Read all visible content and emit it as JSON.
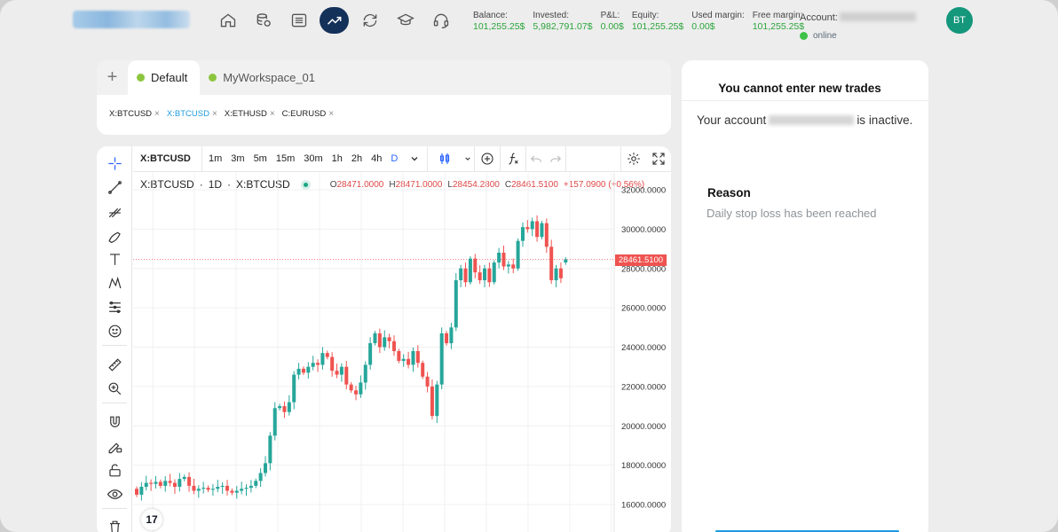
{
  "nav": {
    "icons": [
      "home-icon",
      "database-icon",
      "list-icon",
      "chart-line-icon",
      "refresh-icon",
      "graduation-cap-icon",
      "headset-icon"
    ],
    "active_index": 3
  },
  "stats": [
    {
      "label": "Balance:",
      "value": "101,255.25$"
    },
    {
      "label": "Invested:",
      "value": "5,982,791.07$"
    },
    {
      "label": "P&L:",
      "value": "0.00$"
    },
    {
      "label": "Equity:",
      "value": "101,255.25$"
    },
    {
      "label": "Used margin:",
      "value": "0.00$"
    },
    {
      "label": "Free margin:",
      "value": "101,255.25$"
    }
  ],
  "account": {
    "label": "Account:",
    "status": "online"
  },
  "avatar": {
    "initials": "BT"
  },
  "workspace": {
    "add_label": "+",
    "tabs": [
      {
        "label": "Default"
      },
      {
        "label": "MyWorkspace_01"
      }
    ],
    "symbols": [
      {
        "label": "X:BTCUSD",
        "active": false
      },
      {
        "label": "X:BTCUSD",
        "active": true
      },
      {
        "label": "X:ETHUSD",
        "active": false
      },
      {
        "label": "C:EURUSD",
        "active": false
      }
    ],
    "close_glyph": "×"
  },
  "toolbar": {
    "symbol": "X:BTCUSD",
    "intervals": [
      "1m",
      "3m",
      "5m",
      "15m",
      "30m",
      "1h",
      "2h",
      "4h",
      "D"
    ],
    "active_interval": "D"
  },
  "legend": {
    "symbol": "X:BTCUSD",
    "interval": "1D",
    "exchange": "X:BTCUSD",
    "sep": "·",
    "open_key": "O",
    "open": "28471.0000",
    "high_key": "H",
    "high": "28471.0000",
    "low_key": "L",
    "low": "28454.2800",
    "close_key": "C",
    "close": "28461.5100",
    "change": "+157.0900 (+0.56%)"
  },
  "tv_logo": "17",
  "chart_data": {
    "type": "candlestick",
    "title": "",
    "y_ticks": [
      "32000.0000",
      "30000.0000",
      "28000.0000",
      "26000.0000",
      "24000.0000",
      "22000.0000",
      "20000.0000",
      "18000.0000",
      "16000.0000"
    ],
    "ylim": [
      15500,
      32800
    ],
    "current_price": "28461.5100",
    "up_color": "#26a69a",
    "down_color": "#ef5350",
    "closes": [
      16500,
      16900,
      17100,
      17050,
      17150,
      16950,
      17200,
      17100,
      16900,
      17300,
      17400,
      16950,
      16700,
      16800,
      16850,
      16750,
      16800,
      16900,
      16950,
      16700,
      16600,
      16700,
      16800,
      16850,
      16950,
      17200,
      17600,
      18100,
      19500,
      20900,
      21000,
      20700,
      21200,
      22600,
      22900,
      22700,
      23000,
      23200,
      23100,
      23700,
      23500,
      22800,
      22600,
      23000,
      22100,
      21800,
      21600,
      22200,
      23100,
      24200,
      24700,
      24000,
      24500,
      24300,
      23800,
      23300,
      23400,
      23100,
      23800,
      23200,
      22500,
      22000,
      20500,
      22100,
      24700,
      24200,
      25000,
      27400,
      28000,
      27300,
      28500,
      27800,
      27400,
      28000,
      27300,
      28300,
      28800,
      28100,
      28200,
      28000,
      29400,
      30100,
      30000,
      30400,
      29600,
      30300,
      29100,
      27400,
      28000,
      27500,
      28461.51
    ],
    "opens": [
      16800,
      16500,
      16900,
      17100,
      17050,
      17150,
      16950,
      17200,
      17100,
      16900,
      17300,
      17400,
      16950,
      16700,
      16800,
      16850,
      16750,
      16800,
      16900,
      16950,
      16700,
      16600,
      16700,
      16800,
      16850,
      16950,
      17200,
      17600,
      18100,
      19500,
      20900,
      21000,
      20700,
      21200,
      22600,
      22900,
      22700,
      23000,
      23200,
      23100,
      23700,
      23500,
      22800,
      22600,
      23000,
      22100,
      21800,
      21600,
      22200,
      23100,
      24200,
      24700,
      24000,
      24500,
      24300,
      23800,
      23300,
      23400,
      23100,
      23800,
      23200,
      22500,
      22000,
      20500,
      22100,
      24700,
      24200,
      25000,
      27400,
      28000,
      27300,
      28500,
      27800,
      27400,
      28000,
      27300,
      28300,
      28800,
      28100,
      28200,
      28000,
      29400,
      30100,
      30000,
      30400,
      29600,
      30300,
      29100,
      27400,
      28000,
      28304.42
    ]
  },
  "right_panel": {
    "title": "You cannot enter new trades",
    "msg_prefix": "Your account",
    "msg_suffix": "is inactive.",
    "reason_title": "Reason",
    "reason_text": "Daily stop loss has been reached"
  }
}
